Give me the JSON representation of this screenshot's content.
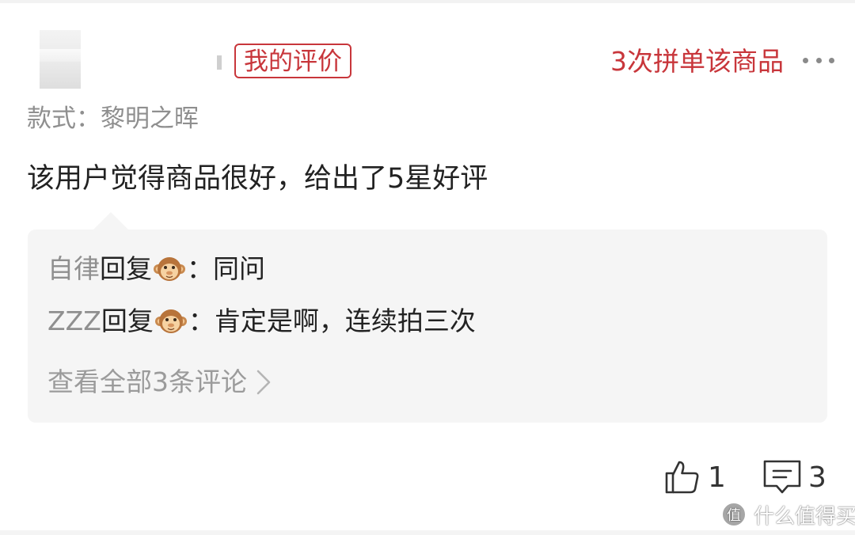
{
  "header": {
    "my_review_tag": "我的评价",
    "repurchase_text": "3次拼单该商品"
  },
  "product": {
    "style_label": "款式：",
    "style_value": "黎明之晖"
  },
  "review": {
    "text": "该用户觉得商品很好，给出了5星好评"
  },
  "replies": [
    {
      "user": "自律",
      "verb": "回复",
      "icon": "monkey-face-icon",
      "content": "：同问"
    },
    {
      "user": "ZZZ",
      "verb": "回复",
      "icon": "monkey-face-icon",
      "content": "：肯定是啊，连续拍三次"
    }
  ],
  "view_all": "查看全部3条评论",
  "actions": {
    "like_icon": "thumbs-up-icon",
    "like_count": "1",
    "comment_icon": "comment-icon",
    "comment_count": "3"
  },
  "watermark": {
    "icon": "zhide-logo-icon",
    "text": "什么值得买"
  },
  "colors": {
    "accent_red": "#c8363b",
    "muted_gray": "#8f8f8f",
    "reply_bg": "#f5f5f5"
  }
}
